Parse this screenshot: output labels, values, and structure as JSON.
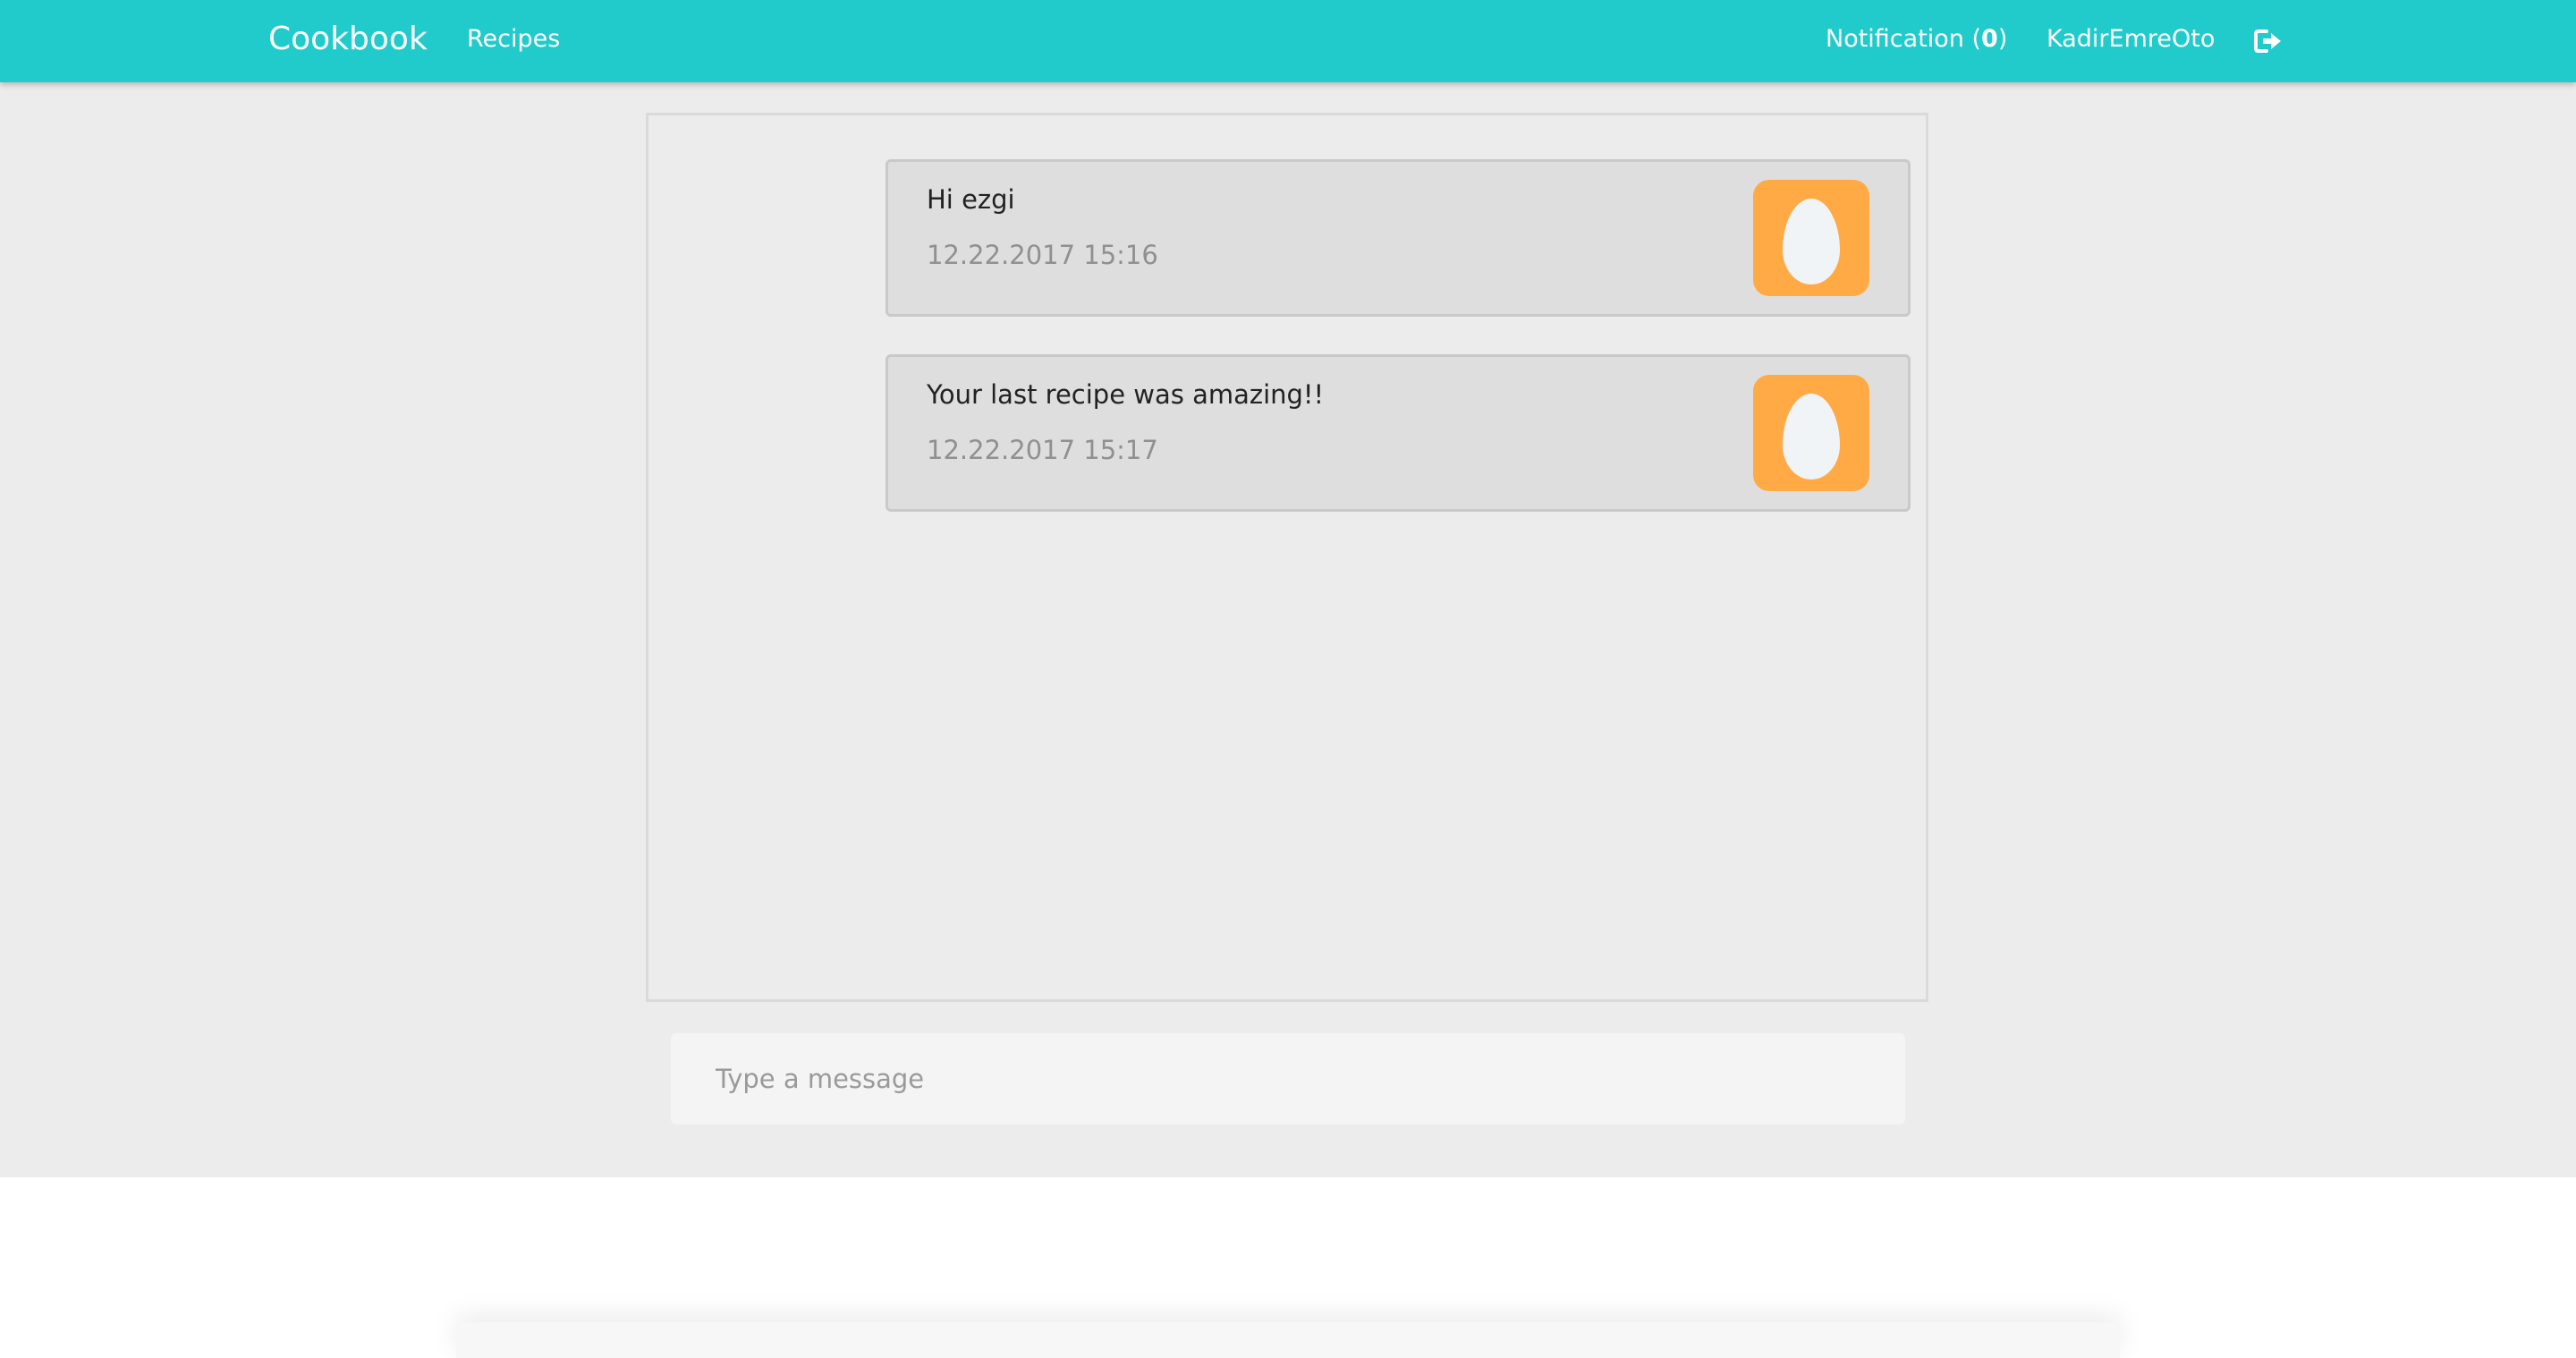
{
  "nav": {
    "brand": "Cookbook",
    "recipes_label": "Recipes",
    "notification_label": "Notification (",
    "notification_count": "0",
    "notification_suffix": ")",
    "username": "KadirEmreOto",
    "logout_icon": "sign-out-icon"
  },
  "chat": {
    "messages": [
      {
        "text": "Hi ezgi",
        "time": "12.22.2017 15:16",
        "avatar_icon": "egg-icon"
      },
      {
        "text": "Your last recipe was amazing!!",
        "time": "12.22.2017 15:17",
        "avatar_icon": "egg-icon"
      }
    ],
    "input": {
      "placeholder": "Type a message",
      "value": ""
    }
  },
  "colors": {
    "navbar": "#21cbcb",
    "page_background": "#ececec",
    "message_background": "#dedede",
    "avatar_background": "#ffaa44",
    "timestamp_text": "#909090"
  }
}
